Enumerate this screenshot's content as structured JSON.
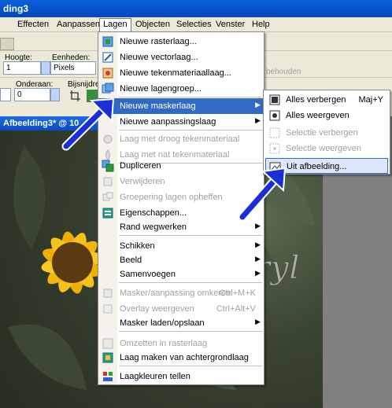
{
  "titlebar": {
    "title": "ding3"
  },
  "menubar": {
    "items": [
      {
        "label": "Effecten"
      },
      {
        "label": "Aanpassen"
      },
      {
        "label": "Lagen"
      },
      {
        "label": "Objecten"
      },
      {
        "label": "Selecties"
      },
      {
        "label": "Venster"
      },
      {
        "label": "Help"
      }
    ]
  },
  "toolbar": {
    "hoogte_label": "Hoogte:",
    "hoogte_value": "1",
    "eenheden_label": "Eenheden:",
    "eenheden_value": "Pixels",
    "onderaan_label": "Onderaan:",
    "onderaan_value": "0",
    "bijsnijd_label": "Bijsnijdrech",
    "behouden_label": "behouden"
  },
  "document": {
    "title": "Afbeelding3* @ 10"
  },
  "layer_menu": {
    "items": [
      {
        "label": "Nieuwe rasterlaag...",
        "enabled": true
      },
      {
        "label": "Nieuwe vectorlaag...",
        "enabled": true
      },
      {
        "label": "Nieuwe tekenmateriaallaag...",
        "enabled": true
      },
      {
        "label": "Nieuwe lagengroep...",
        "enabled": true
      },
      {
        "label": "Nieuwe maskerlaag",
        "enabled": true,
        "submenu": true,
        "highlighted": true
      },
      {
        "label": "Nieuwe aanpassingslaag",
        "enabled": true,
        "submenu": true
      },
      {
        "label": "Laag met droog tekenmateriaal",
        "enabled": false
      },
      {
        "label": "Laag met nat tekenmateriaal",
        "enabled": false
      },
      {
        "label": "Dupliceren",
        "enabled": true
      },
      {
        "label": "Verwijderen",
        "enabled": false
      },
      {
        "label": "Groepering lagen opheffen",
        "enabled": false
      },
      {
        "label": "Eigenschappen...",
        "enabled": true
      },
      {
        "label": "Rand wegwerken",
        "enabled": true,
        "submenu": true
      },
      {
        "label": "Schikken",
        "enabled": true,
        "submenu": true
      },
      {
        "label": "Beeld",
        "enabled": true,
        "submenu": true
      },
      {
        "label": "Samenvoegen",
        "enabled": true,
        "submenu": true
      },
      {
        "label": "Masker/aanpassing omkeren",
        "enabled": false,
        "shortcut": "Ctrl+M+K"
      },
      {
        "label": "Overlay weergeven",
        "enabled": false,
        "shortcut": "Ctrl+Alt+V"
      },
      {
        "label": "Masker laden/opslaan",
        "enabled": true,
        "submenu": true
      },
      {
        "label": "Omzetten in rasterlaag",
        "enabled": false
      },
      {
        "label": "Laag maken van achtergrondlaag",
        "enabled": true
      },
      {
        "label": "Laagkleuren tellen",
        "enabled": true
      }
    ]
  },
  "mask_submenu": {
    "items": [
      {
        "label": "Alles verbergen",
        "shortcut": "Maj+Y",
        "enabled": true
      },
      {
        "label": "Alles weergeven",
        "enabled": true
      },
      {
        "label": "Selectie verbergen",
        "enabled": false
      },
      {
        "label": "Selectie weergeven",
        "enabled": false
      },
      {
        "label": "Uit afbeelding...",
        "enabled": true,
        "selected": true
      }
    ]
  },
  "watermark": {
    "text": "cre@maaryl"
  },
  "colors": {
    "highlight": "#316AC5",
    "arrow": "#1A2FD8",
    "titlebar": "#0A5FD8"
  }
}
